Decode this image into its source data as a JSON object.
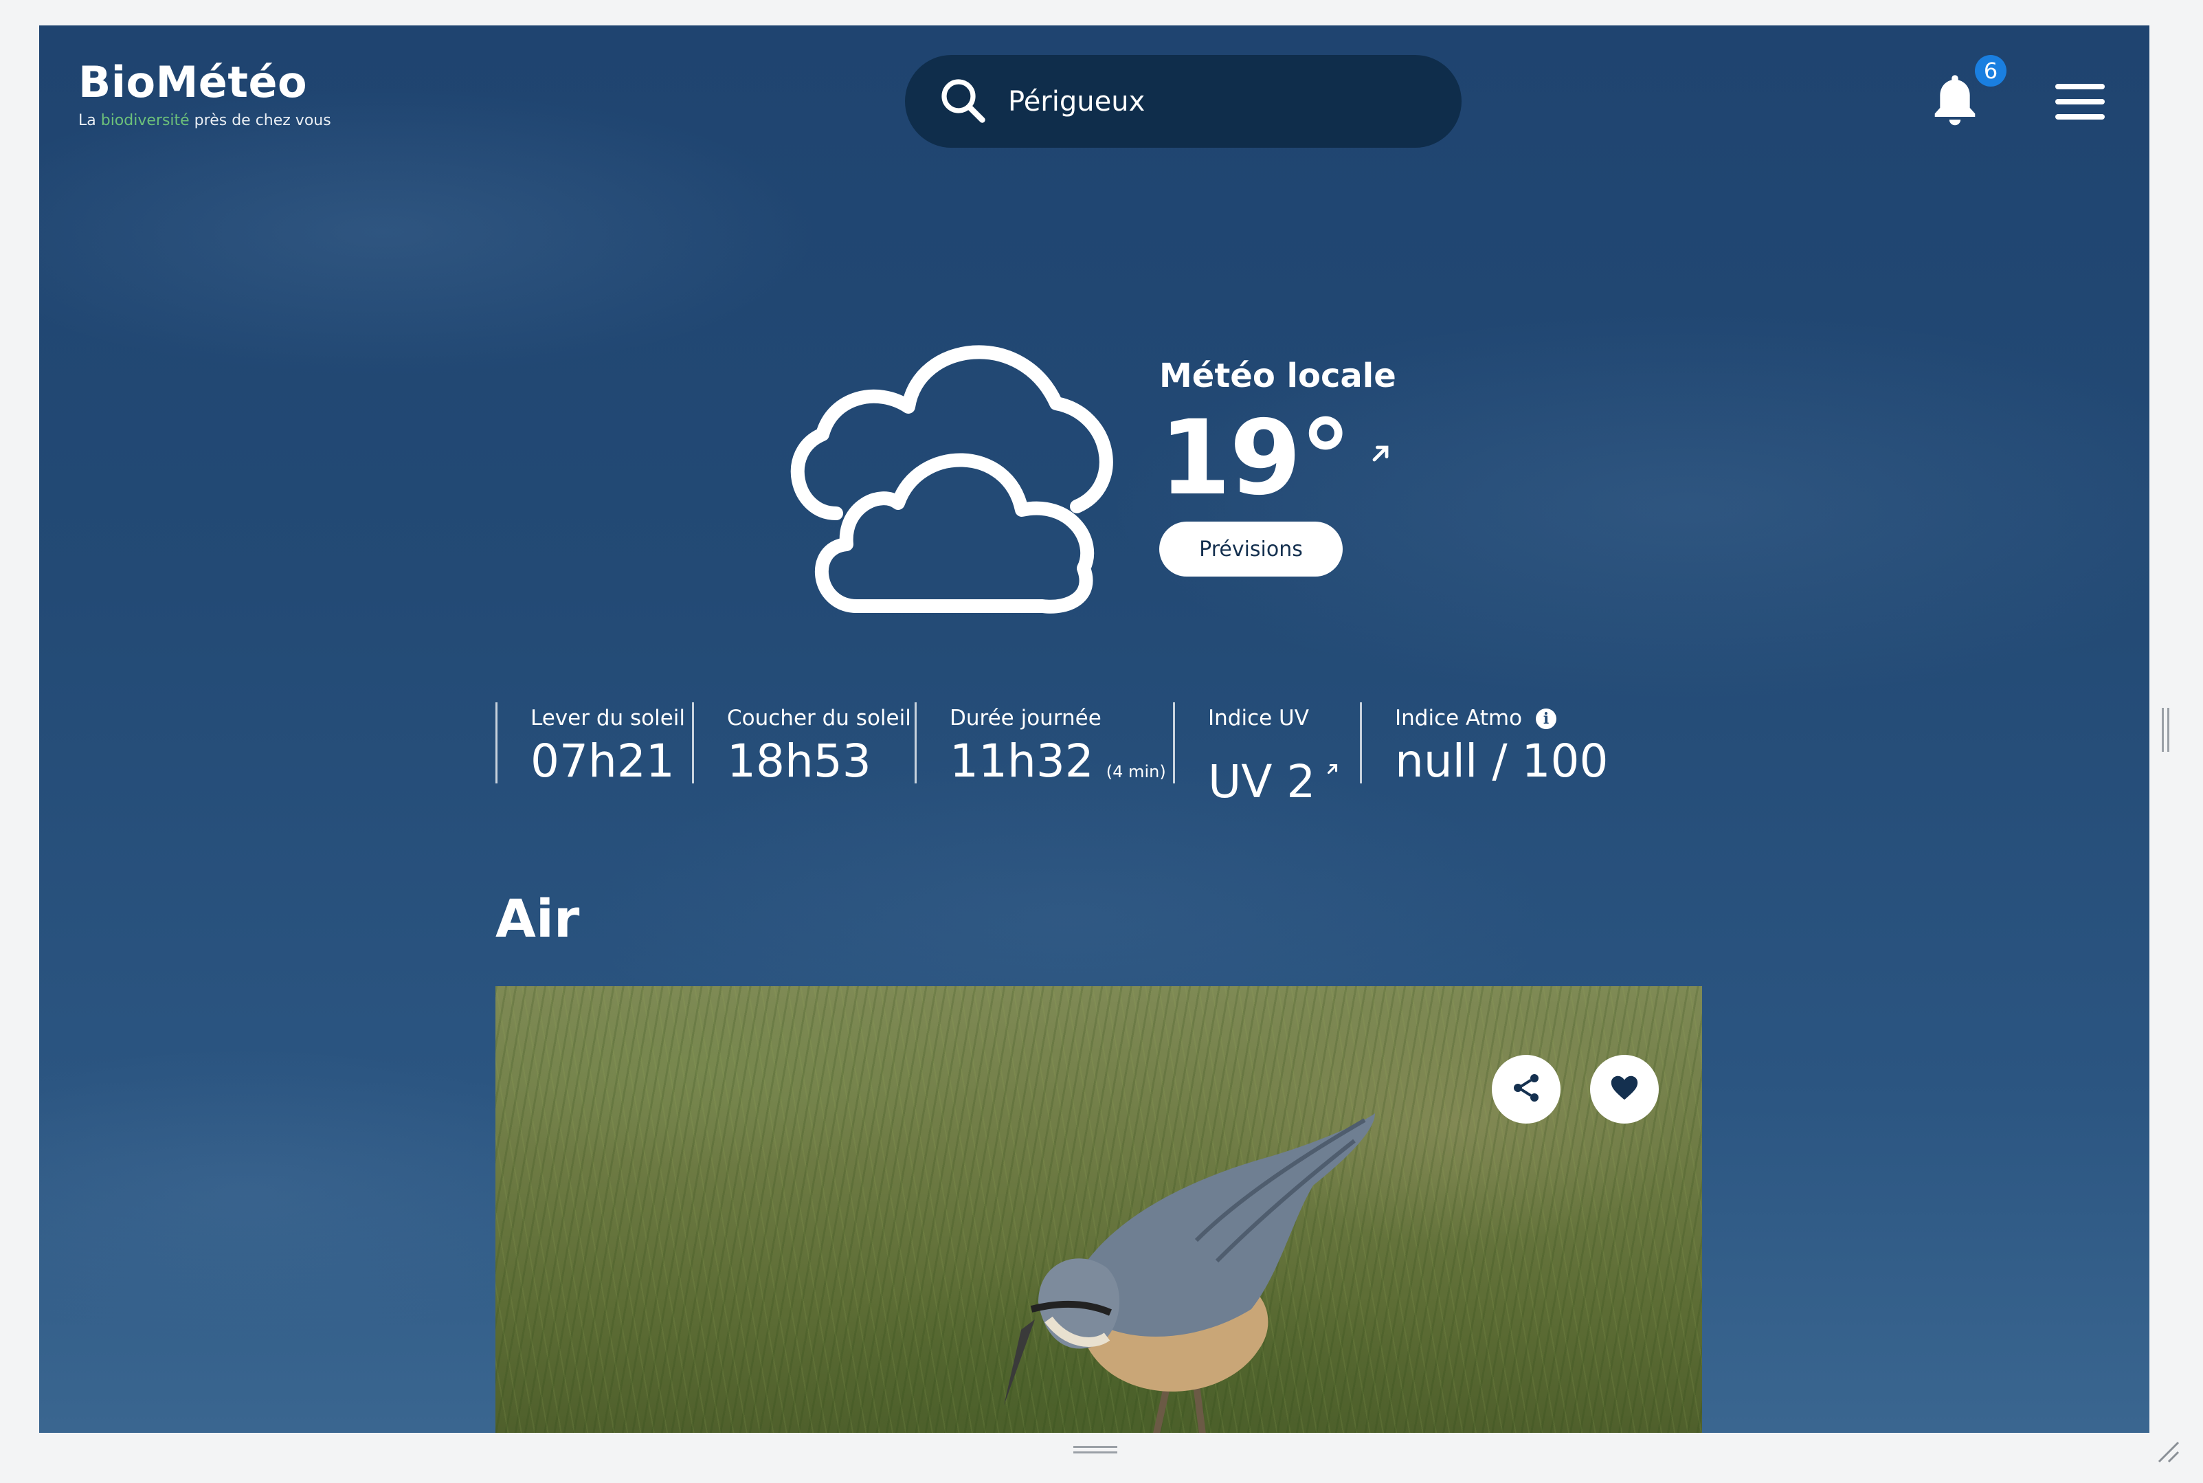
{
  "header": {
    "logo_title": "BioMétéo",
    "logo_sub_prefix": "La ",
    "logo_sub_accent": "biodiversité",
    "logo_sub_suffix": " près de chez vous",
    "search_value": "Périgueux",
    "notification_count": "6",
    "icons": [
      "search-icon",
      "bell-icon",
      "hamburger-menu-icon"
    ]
  },
  "weather": {
    "label": "Météo locale",
    "temperature": "19°",
    "trend_icon": "arrow-up-right-icon",
    "condition_icon": "cloudy-icon",
    "forecast_button": "Prévisions"
  },
  "stats": [
    {
      "label": "Lever du soleil",
      "value": "07h21"
    },
    {
      "label": "Coucher du soleil",
      "value": "18h53"
    },
    {
      "label": "Durée journée",
      "value": "11h32",
      "sub": "(4 min)"
    },
    {
      "label": "Indice UV",
      "value": "UV 2",
      "trend_icon": "arrow-up-right-icon"
    },
    {
      "label": "Indice Atmo",
      "value": "null / 100",
      "info_icon": "info-icon"
    }
  ],
  "section": {
    "title": "Air"
  },
  "card": {
    "image": "nuthatch-bird-photo",
    "share_icon": "share-icon",
    "favorite_icon": "heart-icon"
  },
  "colors": {
    "background": "#234a75",
    "search_bg": "#0f2d4b",
    "badge": "#1a7fe0",
    "accent_green": "#6dc17a",
    "button_text": "#14304f"
  }
}
